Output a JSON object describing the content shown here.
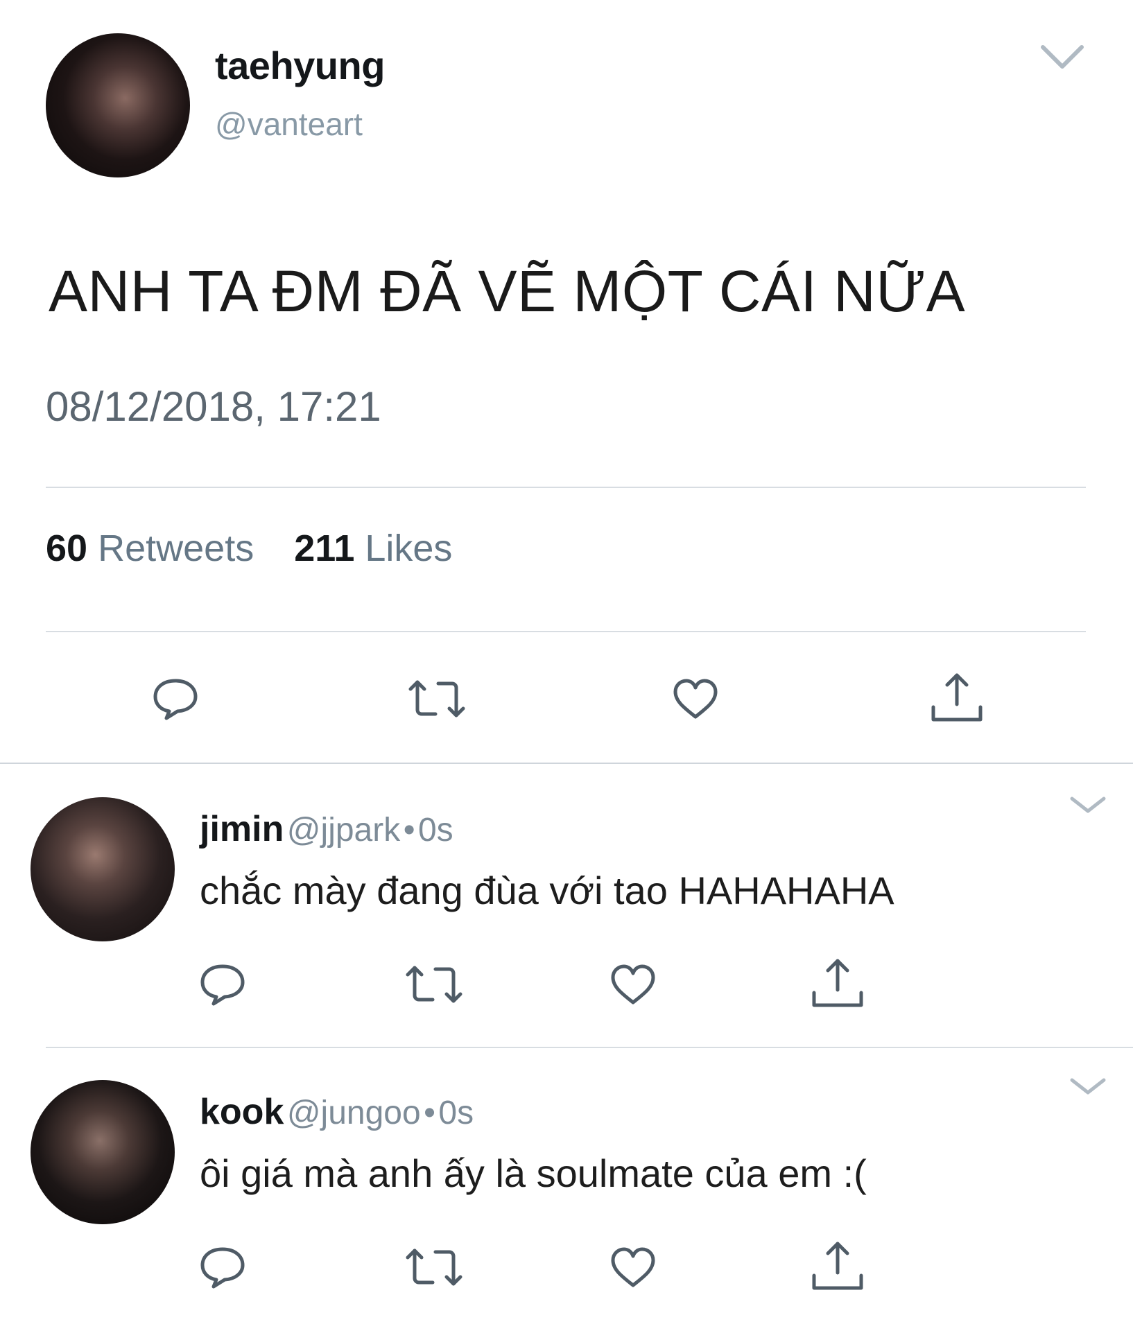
{
  "tweet": {
    "display_name": "taehyung",
    "handle": "@vanteart",
    "text": "ANH TA ĐM ĐÃ VẼ MỘT CÁI NỮA",
    "timestamp": "08/12/2018, 17:21",
    "retweets_count": "60",
    "retweets_label": "Retweets",
    "likes_count": "211",
    "likes_label": "Likes",
    "menu_icon": "chevron-down-icon",
    "actions": [
      "reply-icon",
      "retweet-icon",
      "like-icon",
      "share-icon"
    ]
  },
  "replies": [
    {
      "display_name": "jimin",
      "handle": "@jjpark",
      "separator": "•",
      "time": "0s",
      "text": "chắc mày đang đùa với tao HAHAHAHA"
    },
    {
      "display_name": "kook",
      "handle": "@jungoo",
      "separator": "•",
      "time": "0s",
      "text": "ôi giá mà anh ấy là soulmate của em :("
    }
  ],
  "colors": {
    "icon": "#657786",
    "secondary_text": "#8899a6",
    "divider": "#d8dde2"
  }
}
